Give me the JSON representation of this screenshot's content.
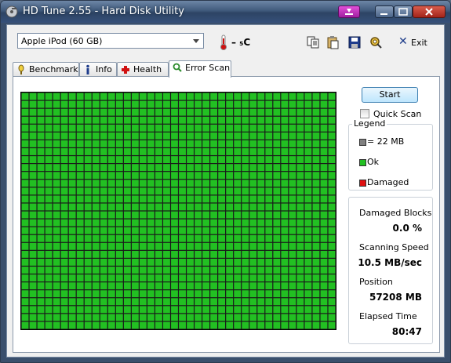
{
  "window": {
    "title": "HD Tune 2.55 - Hard Disk Utility"
  },
  "toolbar": {
    "drive": "Apple   iPod (60 GB)",
    "temperature": "– ₅C",
    "exit_label": "Exit",
    "exit_underline": "x"
  },
  "tabs": [
    {
      "label": "Benchmark",
      "icon": "stopwatch-icon"
    },
    {
      "label": "Info",
      "icon": "info-icon"
    },
    {
      "label": "Health",
      "icon": "health-cross-icon"
    },
    {
      "label": "Error Scan",
      "icon": "magnifier-icon",
      "active": true
    }
  ],
  "scan": {
    "start_label": "Start",
    "quick_scan_label": "Quick Scan",
    "quick_scan_checked": false,
    "grid": {
      "columns": 40,
      "rows": 30,
      "ok_color": "#22c022",
      "damaged_color": "#e01010",
      "damaged_blocks": 0
    }
  },
  "legend": {
    "title": "Legend",
    "items": [
      {
        "label": "= 22 MB",
        "color": "#808080"
      },
      {
        "label": "Ok",
        "color": "#22c022"
      },
      {
        "label": "Damaged",
        "color": "#e01010"
      }
    ]
  },
  "stats": {
    "damaged_blocks_label": "Damaged Blocks",
    "damaged_blocks_value": "0.0 %",
    "scanning_speed_label": "Scanning Speed",
    "scanning_speed_value": "10.5 MB/sec",
    "position_label": "Position",
    "position_value": "57208 MB",
    "elapsed_label": "Elapsed Time",
    "elapsed_value": "80:47"
  }
}
